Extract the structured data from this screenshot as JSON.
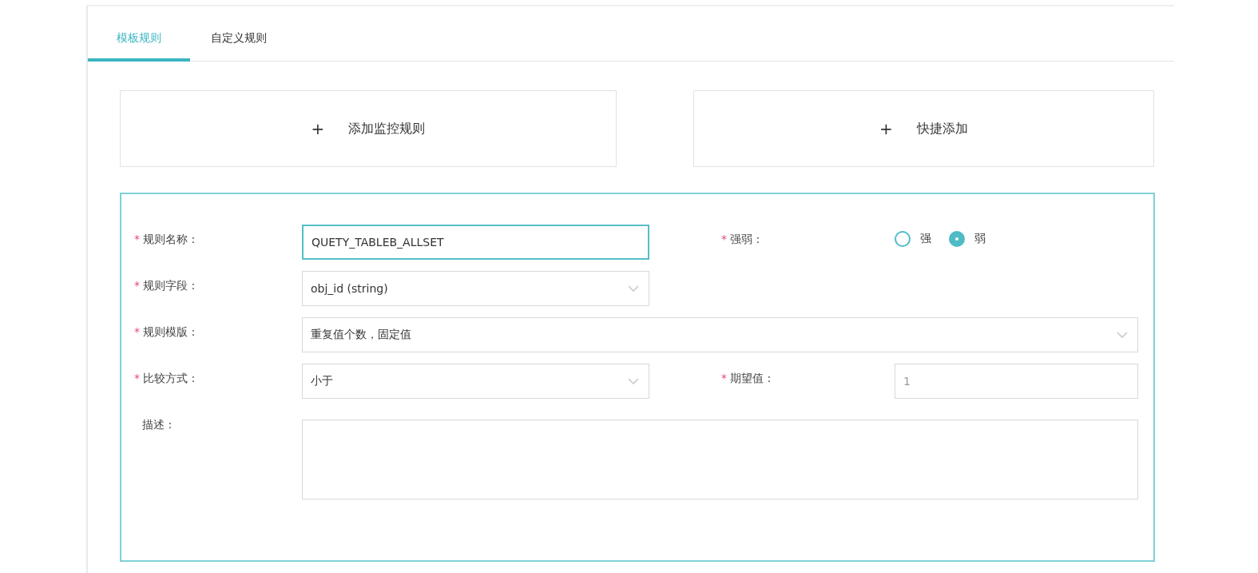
{
  "tabs": [
    {
      "label": "模板规则",
      "selected": true
    },
    {
      "label": "自定义规则",
      "selected": false
    }
  ],
  "add_buttons": [
    {
      "icon": "+",
      "label": "添加监控规则"
    },
    {
      "icon": "+",
      "label": "快捷添加"
    }
  ],
  "form": {
    "rule_name": {
      "label": "规则名称 :",
      "mark": "*",
      "value": "QUETY_TABLEB_ALLSET",
      "focused": true
    },
    "strength": {
      "label": "强弱 :",
      "mark": "*",
      "options": [
        {
          "label": "强",
          "selected": false
        },
        {
          "label": "弱",
          "selected": true
        }
      ]
    },
    "rule_field": {
      "label": "规则字段 :",
      "mark": "*",
      "value": "obj_id (string)"
    },
    "rule_template": {
      "label": "规则模版 :",
      "mark": "*",
      "value": "重复值个数，固定值"
    },
    "compare": {
      "label": "比较方式 :",
      "mark": "*",
      "value": "小于"
    },
    "expected": {
      "label": "期望值 :",
      "mark": "*",
      "placeholder": "1"
    },
    "description": {
      "label": "描述 :"
    }
  }
}
